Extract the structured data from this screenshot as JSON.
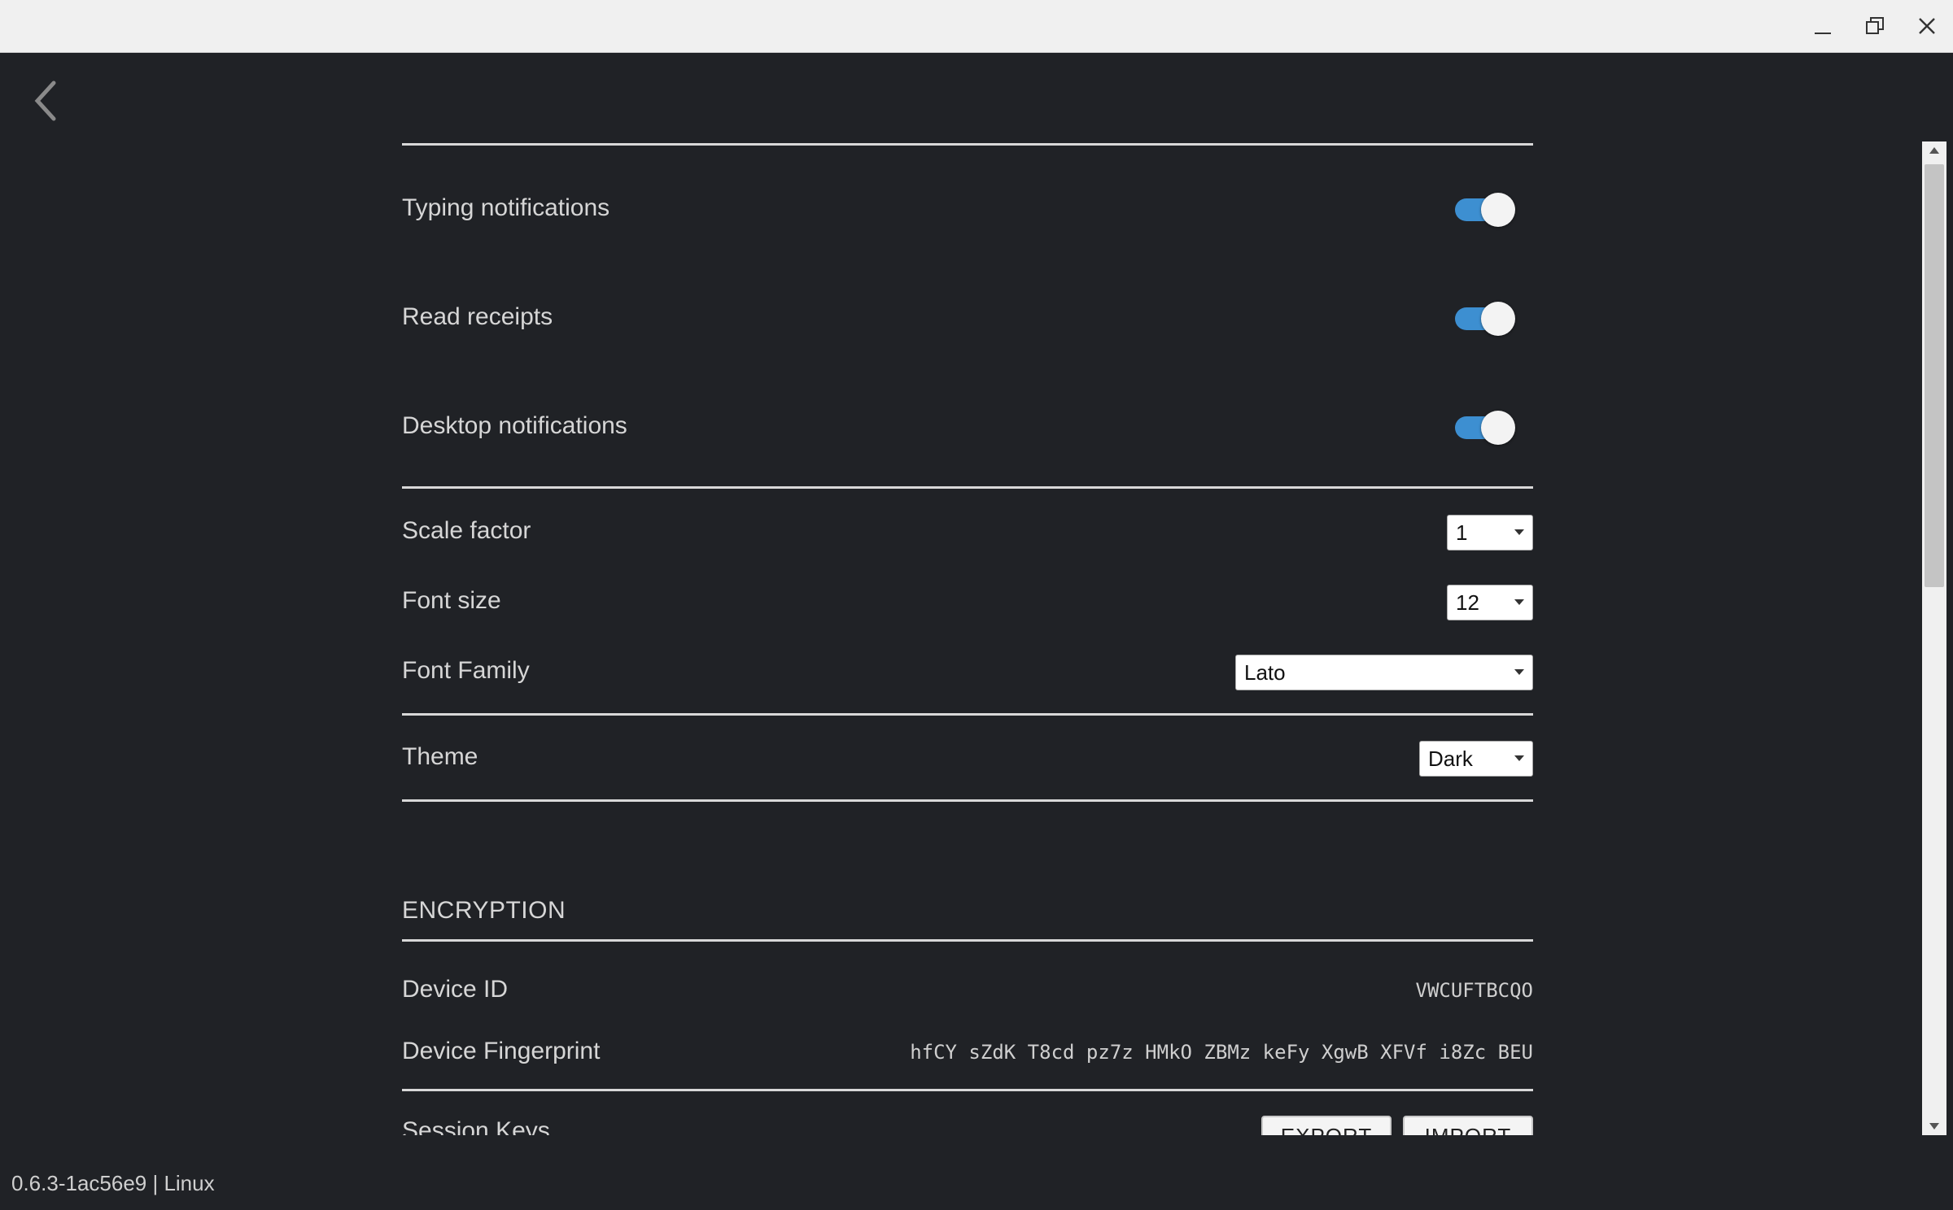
{
  "colors": {
    "background": "#202226",
    "toggle_on": "#3d8fd1",
    "titlebar": "#f0f0f0"
  },
  "window": {
    "minimize_icon": "minimize-icon",
    "maximize_icon": "maximize-icon",
    "close_icon": "close-icon"
  },
  "nav": {
    "back_icon": "chevron-left-icon"
  },
  "settings": {
    "toggles": [
      {
        "label": "Typing notifications",
        "enabled": true
      },
      {
        "label": "Read receipts",
        "enabled": true
      },
      {
        "label": "Desktop notifications",
        "enabled": true
      }
    ],
    "scale_factor": {
      "label": "Scale factor",
      "value": "1"
    },
    "font_size": {
      "label": "Font size",
      "value": "12"
    },
    "font_family": {
      "label": "Font Family",
      "value": "Lato"
    },
    "theme": {
      "label": "Theme",
      "value": "Dark"
    }
  },
  "encryption": {
    "title": "ENCRYPTION",
    "device_id": {
      "label": "Device ID",
      "value": "VWCUFTBCQO"
    },
    "device_fingerprint": {
      "label": "Device Fingerprint",
      "value": "hfCY sZdK T8cd pz7z HMkO ZBMz keFy XgwB XFVf i8Zc BEU"
    },
    "session_keys": {
      "label": "Session Keys",
      "export_label": "EXPORT",
      "import_label": "IMPORT"
    }
  },
  "footer": {
    "version": "0.6.3-1ac56e9 | Linux"
  }
}
